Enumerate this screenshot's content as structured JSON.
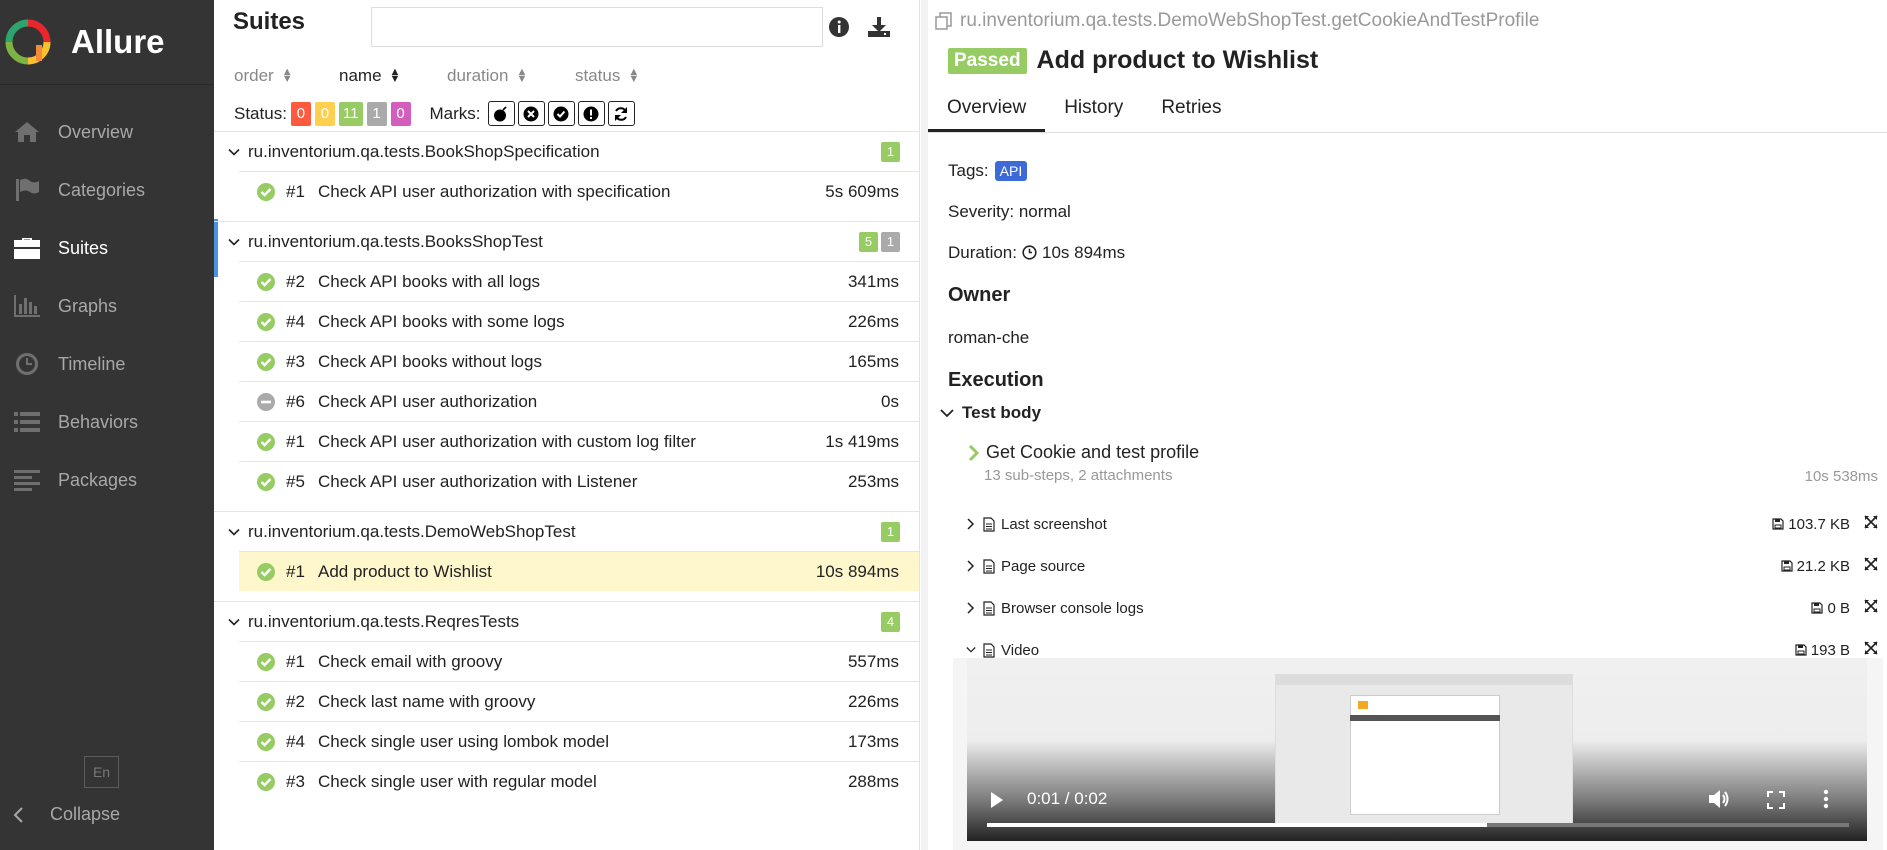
{
  "brand": {
    "name": "Allure"
  },
  "sidebar": {
    "items": [
      {
        "label": "Overview",
        "icon": "home-icon"
      },
      {
        "label": "Categories",
        "icon": "flag-icon"
      },
      {
        "label": "Suites",
        "icon": "briefcase-icon",
        "active": true
      },
      {
        "label": "Graphs",
        "icon": "bar-chart-icon"
      },
      {
        "label": "Timeline",
        "icon": "clock-icon"
      },
      {
        "label": "Behaviors",
        "icon": "list-icon"
      },
      {
        "label": "Packages",
        "icon": "align-left-icon"
      }
    ],
    "language": "En",
    "collapse_label": "Collapse"
  },
  "suites": {
    "title": "Suites",
    "search_value": "",
    "sort": [
      "order",
      "name",
      "duration",
      "status"
    ],
    "status_label": "Status:",
    "status_counts": [
      {
        "value": "0",
        "color": "#fd5a3e"
      },
      {
        "value": "0",
        "color": "#ffd050"
      },
      {
        "value": "11",
        "color": "#97cc64"
      },
      {
        "value": "1",
        "color": "#aaaaaa"
      },
      {
        "value": "0",
        "color": "#d35ebe"
      }
    ],
    "marks_label": "Marks:",
    "groups": [
      {
        "name": "ru.inventorium.qa.tests.BookShopSpecification",
        "counts": [
          {
            "value": "1",
            "color": "#97cc64"
          }
        ],
        "rows": [
          {
            "order": "#1",
            "name": "Check API user authorization with specification",
            "duration": "5s 609ms",
            "status": "passed"
          }
        ]
      },
      {
        "name": "ru.inventorium.qa.tests.BooksShopTest",
        "counts": [
          {
            "value": "5",
            "color": "#97cc64"
          },
          {
            "value": "1",
            "color": "#aaaaaa"
          }
        ],
        "rows": [
          {
            "order": "#2",
            "name": "Check API books with all logs",
            "duration": "341ms",
            "status": "passed"
          },
          {
            "order": "#4",
            "name": "Check API books with some logs",
            "duration": "226ms",
            "status": "passed"
          },
          {
            "order": "#3",
            "name": "Check API books without logs",
            "duration": "165ms",
            "status": "passed"
          },
          {
            "order": "#6",
            "name": "Check API user authorization",
            "duration": "0s",
            "status": "skipped"
          },
          {
            "order": "#1",
            "name": "Check API user authorization with custom log filter",
            "duration": "1s 419ms",
            "status": "passed"
          },
          {
            "order": "#5",
            "name": "Check API user authorization with Listener",
            "duration": "253ms",
            "status": "passed"
          }
        ]
      },
      {
        "name": "ru.inventorium.qa.tests.DemoWebShopTest",
        "counts": [
          {
            "value": "1",
            "color": "#97cc64"
          }
        ],
        "rows": [
          {
            "order": "#1",
            "name": "Add product to Wishlist",
            "duration": "10s 894ms",
            "status": "passed",
            "selected": true
          }
        ]
      },
      {
        "name": "ru.inventorium.qa.tests.ReqresTests",
        "counts": [
          {
            "value": "4",
            "color": "#97cc64"
          }
        ],
        "rows": [
          {
            "order": "#1",
            "name": "Check email with groovy",
            "duration": "557ms",
            "status": "passed"
          },
          {
            "order": "#2",
            "name": "Check last name with groovy",
            "duration": "226ms",
            "status": "passed"
          },
          {
            "order": "#4",
            "name": "Check single user using lombok model",
            "duration": "173ms",
            "status": "passed"
          },
          {
            "order": "#3",
            "name": "Check single user with regular model",
            "duration": "288ms",
            "status": "passed"
          }
        ]
      }
    ]
  },
  "details": {
    "full_name": "ru.inventorium.qa.tests.DemoWebShopTest.getCookieAndTestProfile",
    "status": "Passed",
    "status_color": "#97cc64",
    "title": "Add product to Wishlist",
    "tabs": [
      "Overview",
      "History",
      "Retries"
    ],
    "tags_label": "Tags:",
    "tag": "API",
    "severity": "Severity: normal",
    "duration_label": "Duration:",
    "duration": "10s 894ms",
    "owner_title": "Owner",
    "owner": "roman-che",
    "execution_title": "Execution",
    "test_body": "Test body",
    "step": {
      "title": "Get Cookie and test profile",
      "sub": "13 sub-steps, 2 attachments",
      "duration": "10s 538ms"
    },
    "attachments": [
      {
        "name": "Last screenshot",
        "size": "103.7 KB",
        "file_icon": "image-file-icon",
        "expanded": false
      },
      {
        "name": "Page source",
        "size": "21.2 KB",
        "file_icon": "text-file-icon",
        "expanded": false
      },
      {
        "name": "Browser console logs",
        "size": "0 B",
        "file_icon": "text-file-icon",
        "expanded": false
      },
      {
        "name": "Video",
        "size": "193 B",
        "file_icon": "video-file-icon",
        "expanded": true
      }
    ],
    "video": {
      "time": "0:01 / 0:02",
      "progress": 0.58
    }
  }
}
